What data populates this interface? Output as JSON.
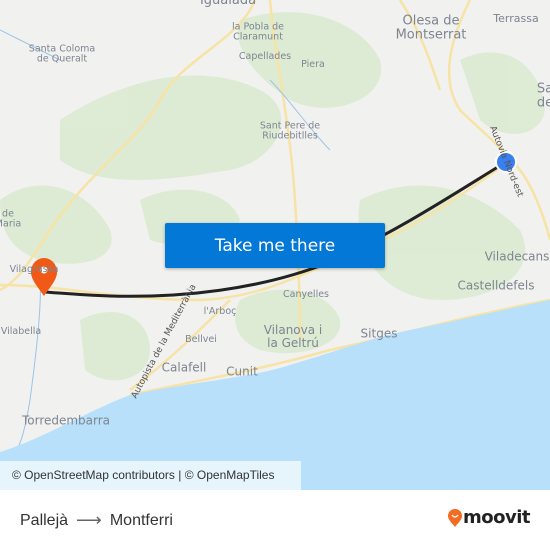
{
  "map": {
    "labels": {
      "igualada": "Igualada",
      "pobla": "la Pobla de\nClaramunt",
      "capellades": "Capellades",
      "piera": "Piera",
      "olesa": "Olesa de\nMontserrat",
      "terrassa": "Terrassa",
      "santa_coloma": "Santa Coloma\nde Queralt",
      "sant_pere": "Sant Pere de\nRiudebitlles",
      "sa_de": "Sa\nde",
      "autovia": "Autovia Nord-est",
      "de_maria": "de\nMaria",
      "vila_label": "Vilagrassa",
      "viladecans": "Viladecans",
      "castelldefels": "Castelldefels",
      "canyelles": "Canyelles",
      "arboc": "l'Arboç",
      "vilabella": "Vilabella",
      "autopista": "Autopista de la Mediterrània",
      "bellvei": "Bellvei",
      "vilanova": "Vilanova i\nla Geltrú",
      "sitges": "Sitges",
      "calafell": "Calafell",
      "cunit": "Cunit",
      "torredembarra": "Torredembarra"
    },
    "origin_color": "#3a7ff0",
    "destination_color": "#f05a16",
    "route_color": "#222222",
    "sea_color": "#b8e0fb"
  },
  "cta": {
    "label": "Take me there",
    "color": "#0478d6"
  },
  "attribution": "© OpenStreetMap contributors | © OpenMapTiles",
  "footer": {
    "origin": "Pallejà",
    "destination": "Montferri",
    "arrow_icon": "arrow-right-icon",
    "brand": "moovit",
    "brand_color": "#f26d21"
  }
}
